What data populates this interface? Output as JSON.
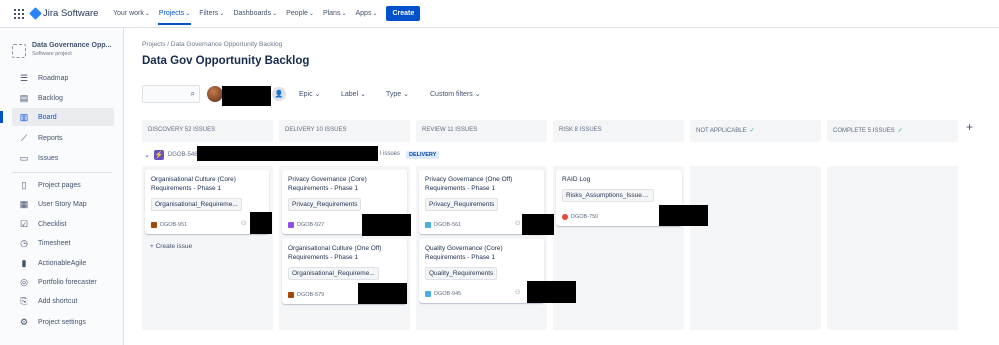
{
  "topbar": {
    "product": "Jira Software",
    "nav": [
      {
        "label": "Your work",
        "active": false
      },
      {
        "label": "Projects",
        "active": true
      },
      {
        "label": "Filters",
        "active": false
      },
      {
        "label": "Dashboards",
        "active": false
      },
      {
        "label": "People",
        "active": false
      },
      {
        "label": "Plans",
        "active": false
      },
      {
        "label": "Apps",
        "active": false
      }
    ],
    "create_label": "Create"
  },
  "sidebar": {
    "project_name": "Data Governance Opp...",
    "project_type": "Software project",
    "items": [
      {
        "label": "Roadmap",
        "icon": "roadmap-icon"
      },
      {
        "label": "Backlog",
        "icon": "backlog-icon"
      },
      {
        "label": "Board",
        "icon": "board-icon",
        "active": true
      },
      {
        "label": "Reports",
        "icon": "reports-icon"
      },
      {
        "label": "Issues",
        "icon": "issues-icon"
      },
      {
        "label": "Project pages",
        "icon": "pages-icon"
      },
      {
        "label": "User Story Map",
        "icon": "story-map-icon"
      },
      {
        "label": "Checklist",
        "icon": "checklist-icon"
      },
      {
        "label": "Timesheet",
        "icon": "timesheet-icon"
      },
      {
        "label": "ActionableAgile",
        "icon": "chart-icon"
      },
      {
        "label": "Portfolio forecaster",
        "icon": "forecaster-icon"
      },
      {
        "label": "Add shortcut",
        "icon": "add-shortcut-icon"
      },
      {
        "label": "Project settings",
        "icon": "settings-icon"
      }
    ]
  },
  "main": {
    "breadcrumb": "Projects  /  Data Governance Opportunity Backlog",
    "title": "Data Gov Opportunity Backlog",
    "filters": {
      "epic": "Epic",
      "label": "Label",
      "type": "Type",
      "custom": "Custom filters"
    }
  },
  "columns": [
    {
      "title": "DISCOVERY 52 ISSUES",
      "check": ""
    },
    {
      "title": "DELIVERY 10 ISSUES",
      "check": ""
    },
    {
      "title": "REVIEW 11 ISSUES",
      "check": ""
    },
    {
      "title": "RISK 8 ISSUES",
      "check": ""
    },
    {
      "title": "NOT APPLICABLE",
      "check": "✓"
    },
    {
      "title": "COMPLETE 5 ISSUES",
      "check": "✓"
    }
  ],
  "swimlane": {
    "key": "DGOB-546",
    "issues_suffix": "l issues",
    "status": "DELIVERY"
  },
  "cards": {
    "c1": {
      "title": "Organisational Culture (Core) Requirements - Phase 1",
      "label": "Organisational_Requireme...",
      "key": "DGOB-951"
    },
    "c2": {
      "title": "Privacy Governance (Core) Requirements - Phase 1",
      "label": "Privacy_Requirements",
      "key": "DGOB-927"
    },
    "c3": {
      "title": "Organisational Culture (One Off) Requirements - Phase 1",
      "label": "Organisational_Requireme...",
      "key": "DGOB-579"
    },
    "c4": {
      "title": "Privacy Governance (One Off) Requirements - Phase 1",
      "label": "Privacy_Requirements",
      "key": "DGOB-561"
    },
    "c5": {
      "title": "Quality Governance (Core) Requirements - Phase 1",
      "label": "Quality_Requirements",
      "key": "DGOB-945"
    },
    "c6": {
      "title": "RAID Log",
      "label": "Risks_Assumptions_Issues_...",
      "key": "DGOB-750"
    }
  },
  "create_issue": "+ Create issue"
}
